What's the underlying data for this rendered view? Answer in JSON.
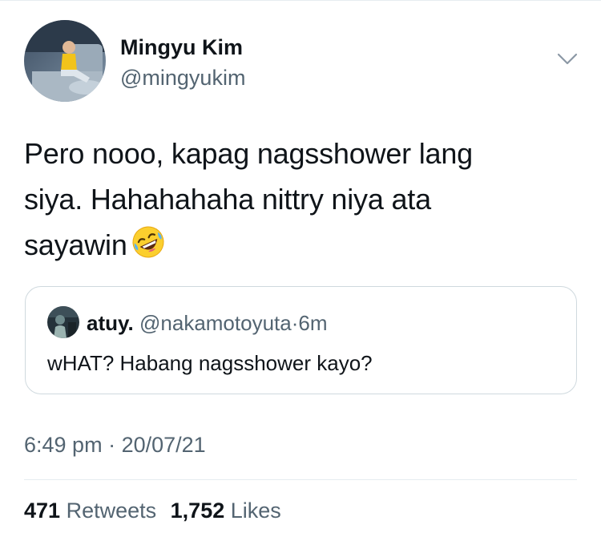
{
  "author": {
    "name": "Mingyu Kim",
    "handle": "@mingyukim"
  },
  "tweet": {
    "line1": "Pero nooo, kapag nagsshower lang",
    "line2": "siya. Hahahahaha nittry niya ata",
    "line3": "sayawin",
    "emoji": "rolling-on-the-floor-laughing"
  },
  "quote": {
    "name": "atuy.",
    "handle": "@nakamotoyuta",
    "separator": "·",
    "time": "6m",
    "text": "wHAT? Habang nagsshower kayo?"
  },
  "meta": {
    "time": "6:49 pm",
    "separator": "·",
    "date": "20/07/21"
  },
  "stats": {
    "retweets": "471",
    "retweets_label": "Retweets",
    "likes": "1,752",
    "likes_label": "Likes"
  },
  "colors": {
    "text": "#0f1419",
    "secondary": "#536471",
    "border": "#cfd9de"
  }
}
